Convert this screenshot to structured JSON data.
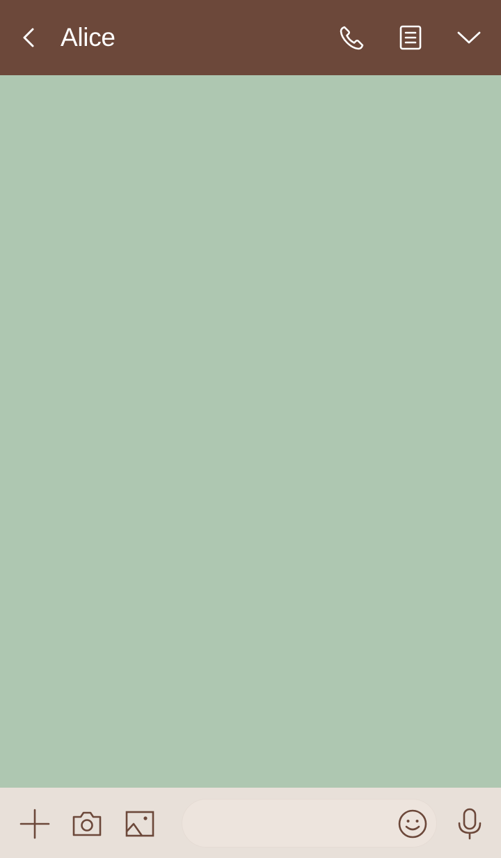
{
  "header": {
    "title": "Alice",
    "background_color": "#6c483a",
    "text_color": "#ffffff",
    "icons": [
      "back-arrow-icon",
      "phone-icon",
      "notes-icon",
      "chevron-down-icon"
    ]
  },
  "chat": {
    "background_color": "#aec7b1"
  },
  "footer": {
    "background_color": "#e8e0d9",
    "icon_color": "#6c483a",
    "icons": [
      "plus-icon",
      "camera-icon",
      "image-icon",
      "smiley-icon",
      "microphone-icon"
    ],
    "message_input": {
      "value": "",
      "placeholder": ""
    }
  }
}
